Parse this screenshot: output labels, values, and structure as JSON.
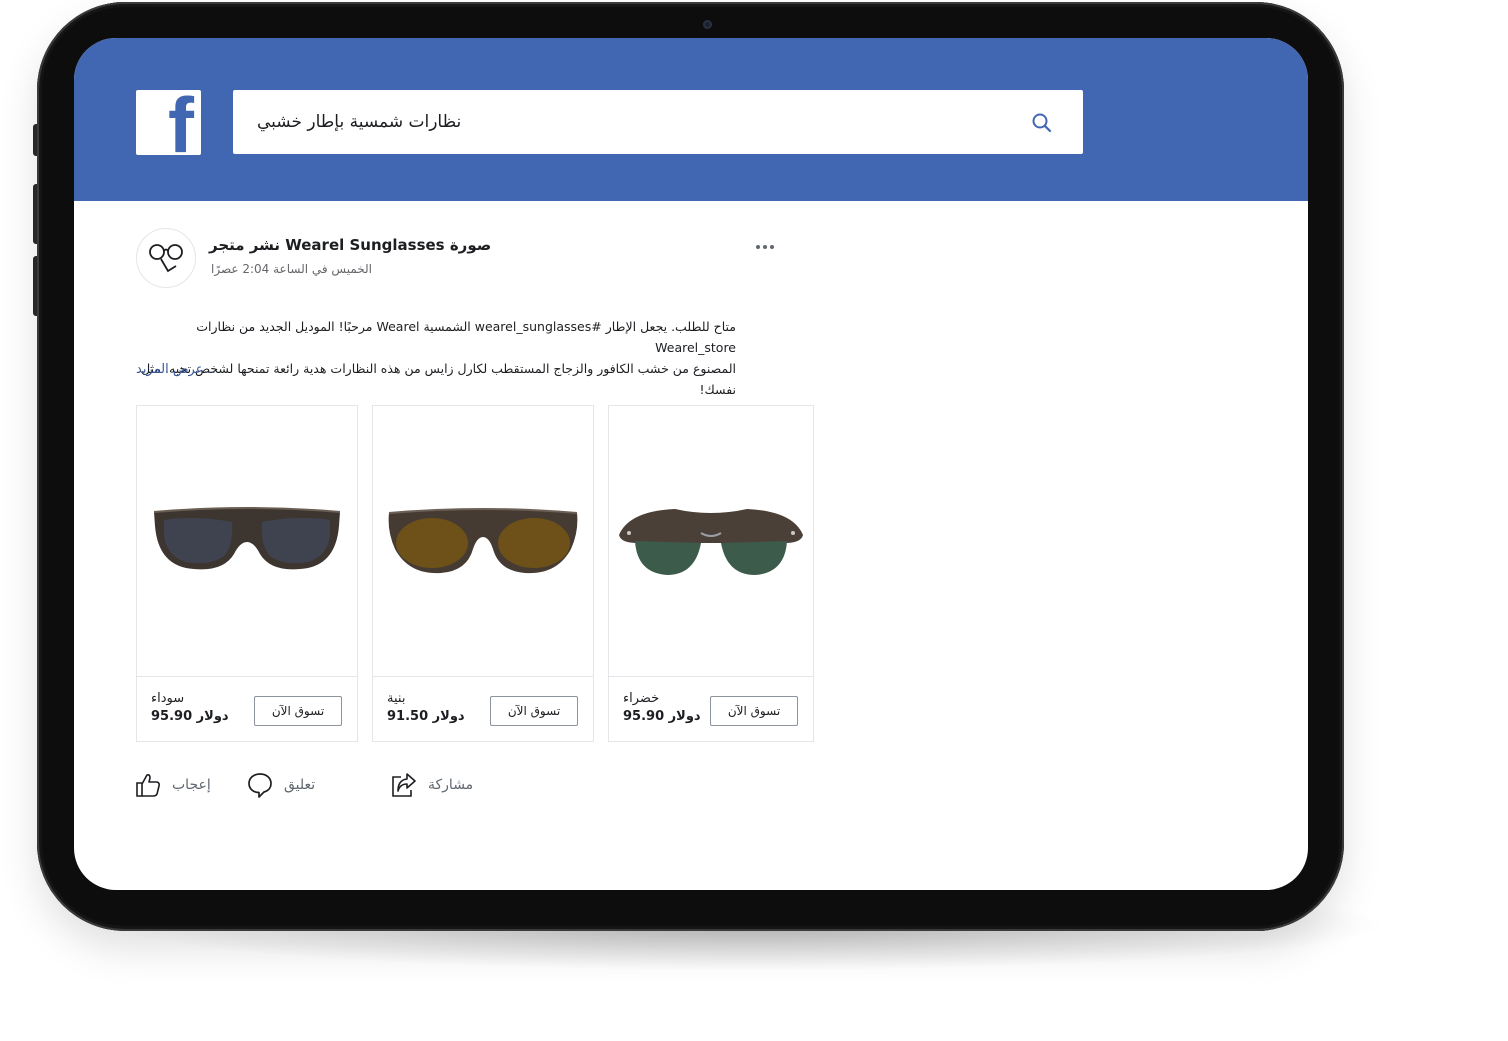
{
  "search": {
    "query": "نظارات شمسية بإطار خشبي"
  },
  "post": {
    "title": "نشر متجر Wearel Sunglasses صورة",
    "time": "الخميس في الساعة 2:04 عصرًا",
    "body_line1": "متاح للطلب. يجعل الإطار #wearel_sunglasses الشمسية Wearel مرحبًا! الموديل الجديد من نظارات Wearel_store",
    "body_line2": "المصنوع من خشب الكافور والزجاج المستقطب لكارل زايس من هذه النظارات هدية رائعة تمنحها لشخص تحبه. مثل نفسك!",
    "see_more": "عرض المزيد..."
  },
  "products": [
    {
      "name": "سوداء",
      "price": "95.90 دولار",
      "button": "تسوق الآن",
      "lens_color": "#3f4350"
    },
    {
      "name": "بنية",
      "price": "91.50 دولار",
      "button": "تسوق الآن",
      "lens_color": "#6e5119"
    },
    {
      "name": "خضراء",
      "price": "95.90 دولار",
      "button": "تسوق الآن",
      "lens_color": "#3d5b4a"
    }
  ],
  "actions": {
    "like": "إعجاب",
    "comment": "تعليق",
    "share": "مشاركة"
  },
  "colors": {
    "facebook_blue": "#4267b2",
    "link": "#385898"
  },
  "icons": [
    "facebook-logo-icon",
    "search-icon",
    "glasses-avatar-icon",
    "more-dots-icon",
    "like-icon",
    "comment-icon",
    "share-icon"
  ]
}
